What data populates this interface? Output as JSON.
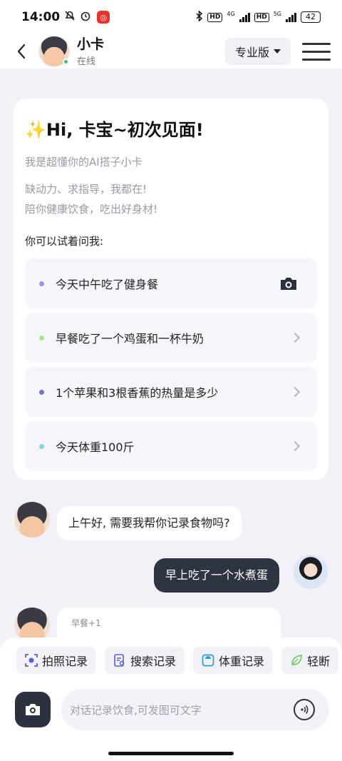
{
  "status_bar": {
    "time": "14:00",
    "network_5g": "5G",
    "network_4g": "4G",
    "hd": "HD",
    "battery": "42"
  },
  "header": {
    "name": "小卡",
    "status": "在线",
    "plan_label": "专业版"
  },
  "welcome": {
    "title": "✨Hi, 卡宝~初次见面!",
    "subtitle": "我是超懂你的AI搭子小卡",
    "desc_line1": "缺动力、求指导，我都在!",
    "desc_line2": "陪你健康饮食，吃出好身材!",
    "ask_label": "你可以试着问我:",
    "suggestions": [
      {
        "text": "今天中午吃了健身餐",
        "dot_color": "#9a8fe6"
      },
      {
        "text": "早餐吃了一个鸡蛋和一杯牛奶",
        "dot_color": "#a7e38c"
      },
      {
        "text": "1个苹果和3根香蕉的热量是多少",
        "dot_color": "#6f74cf"
      },
      {
        "text": "今天体重100斤",
        "dot_color": "#7fd3ea"
      }
    ]
  },
  "chat": {
    "bot_greeting": "上午好, 需要我帮你记录食物吗?",
    "user_message": "早上吃了一个水煮蛋",
    "bot_partial_tag": "早餐+1"
  },
  "quick_actions": [
    {
      "label": "拍照记录",
      "icon": "camera-scan-icon"
    },
    {
      "label": "搜索记录",
      "icon": "search-doc-icon"
    },
    {
      "label": "体重记录",
      "icon": "scale-icon"
    },
    {
      "label": "轻断",
      "icon": "leaf-icon"
    }
  ],
  "input": {
    "placeholder": "对话记录饮食,可发图可文字"
  },
  "colors": {
    "accent_dark": "#2f3443",
    "online": "#3fc16b",
    "background": "#f1f1f7"
  }
}
